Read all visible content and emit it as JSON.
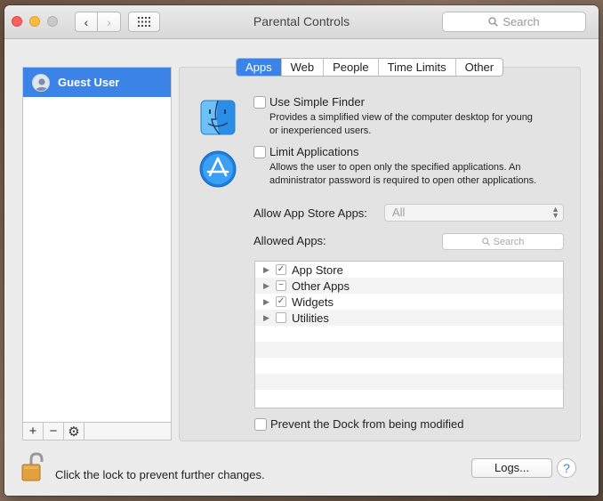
{
  "window": {
    "title": "Parental Controls",
    "search_placeholder": "Search",
    "nav_back_glyph": "‹",
    "nav_forward_glyph": "›"
  },
  "users": {
    "items": [
      {
        "label": "Guest User",
        "selected": true
      }
    ],
    "tools": [
      "+",
      "−",
      "⚙"
    ]
  },
  "tabs": [
    {
      "label": "Apps",
      "active": true
    },
    {
      "label": "Web",
      "active": false
    },
    {
      "label": "People",
      "active": false
    },
    {
      "label": "Time Limits",
      "active": false
    },
    {
      "label": "Other",
      "active": false
    }
  ],
  "options": {
    "simple_finder": {
      "label": "Use Simple Finder",
      "desc1": "Provides a simplified view of the computer desktop for young",
      "desc2": "or inexperienced users.",
      "checked": false
    },
    "limit_apps": {
      "label": "Limit Applications",
      "desc1": "Allows the user to open only the specified applications. An",
      "desc2": "administrator password is required to open other applications.",
      "checked": false
    }
  },
  "app_store": {
    "label": "Allow App Store Apps:",
    "value": "All"
  },
  "allowed_apps": {
    "label": "Allowed Apps:",
    "search_placeholder": "Search",
    "rows": [
      {
        "label": "App Store",
        "state": "✓"
      },
      {
        "label": "Other Apps",
        "state": "−"
      },
      {
        "label": "Widgets",
        "state": "✓"
      },
      {
        "label": "Utilities",
        "state": ""
      }
    ]
  },
  "prevent_dock": {
    "label": "Prevent the Dock from being modified",
    "checked": false
  },
  "footer": {
    "lock_text": "Click the lock to prevent further changes.",
    "logs_label": "Logs...",
    "help_label": "?"
  },
  "colors": {
    "accent": "#3b83e6",
    "window_bg": "#ececec",
    "close": "#fc605c",
    "minimize": "#fdbc40",
    "zoom": "#c9c9c9"
  },
  "icons": {
    "finder": "finder-icon",
    "app_store": "app-store-icon",
    "lock": "lock-icon",
    "search": "search-icon",
    "gear": "gear-icon"
  }
}
